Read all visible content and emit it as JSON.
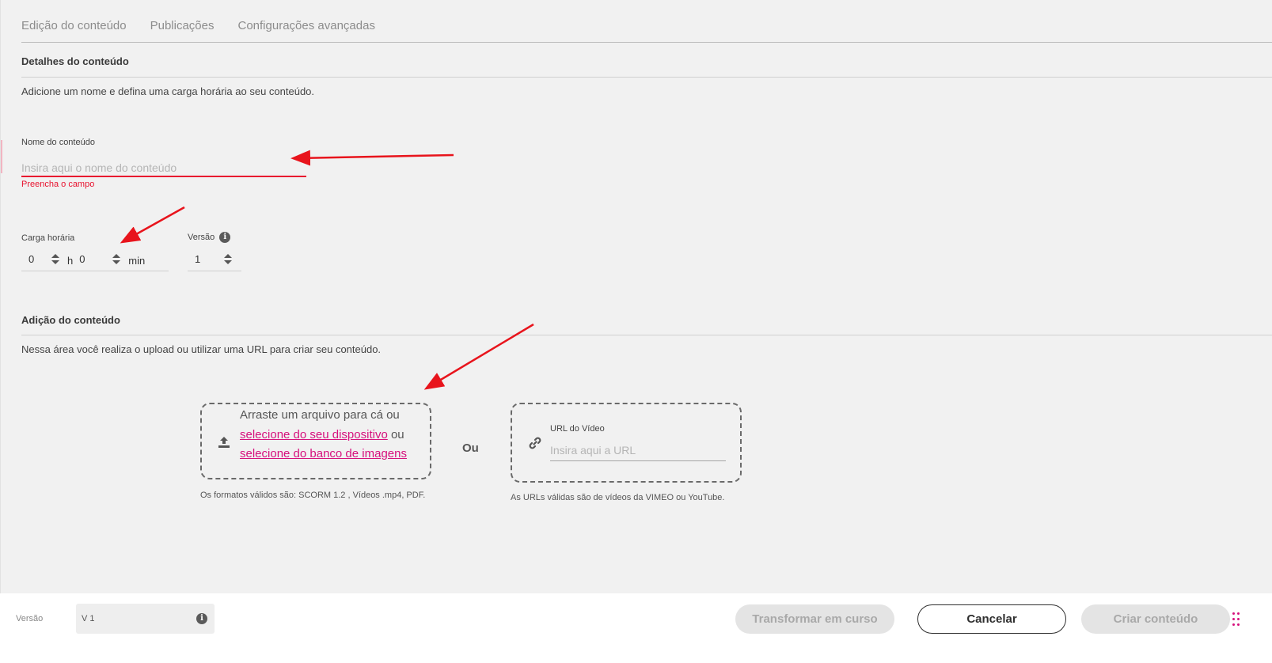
{
  "tabs": [
    {
      "label": "Edição do conteúdo"
    },
    {
      "label": "Publicações"
    },
    {
      "label": "Configurações avançadas"
    }
  ],
  "details": {
    "title": "Detalhes do conteúdo",
    "description": "Adicione um nome e defina uma carga horária ao seu conteúdo.",
    "name_label": "Nome do conteúdo",
    "name_placeholder": "Insira aqui o nome do conteúdo",
    "name_value": "",
    "name_error": "Preencha o campo",
    "workload_label": "Carga horária",
    "hours_value": "0",
    "hours_unit": "h",
    "minutes_value": "0",
    "minutes_unit": "min",
    "version_label": "Versão",
    "version_value": "1"
  },
  "addition": {
    "title": "Adição do conteúdo",
    "description": "Nessa área você realiza o upload ou utilizar uma URL para criar seu conteúdo.",
    "drop_text_1": "Arraste um arquivo para cá ou",
    "drop_link_device": "selecione do seu dispositivo",
    "drop_text_2": "ou",
    "drop_link_bank": "selecione do banco de imagens",
    "formats_hint": "Os formatos válidos são: SCORM 1.2 , Vídeos .mp4, PDF.",
    "or_label": "Ou",
    "url_label": "URL do Vídeo",
    "url_placeholder": "Insira aqui a URL",
    "url_hint": "As URLs válidas são de vídeos da VIMEO ou YouTube."
  },
  "footer": {
    "version_label": "Versão",
    "version_value": "V 1",
    "transform_button": "Transformar em curso",
    "cancel_button": "Cancelar",
    "create_button": "Criar conteúdo"
  },
  "colors": {
    "accent_pink": "#d6127d",
    "error_red": "#e8132f",
    "annotation_red": "#e8141c"
  },
  "icons": {
    "version_info": "info-icon",
    "upload": "upload-icon",
    "url": "link-icon",
    "apps": "dots-grid-icon"
  }
}
